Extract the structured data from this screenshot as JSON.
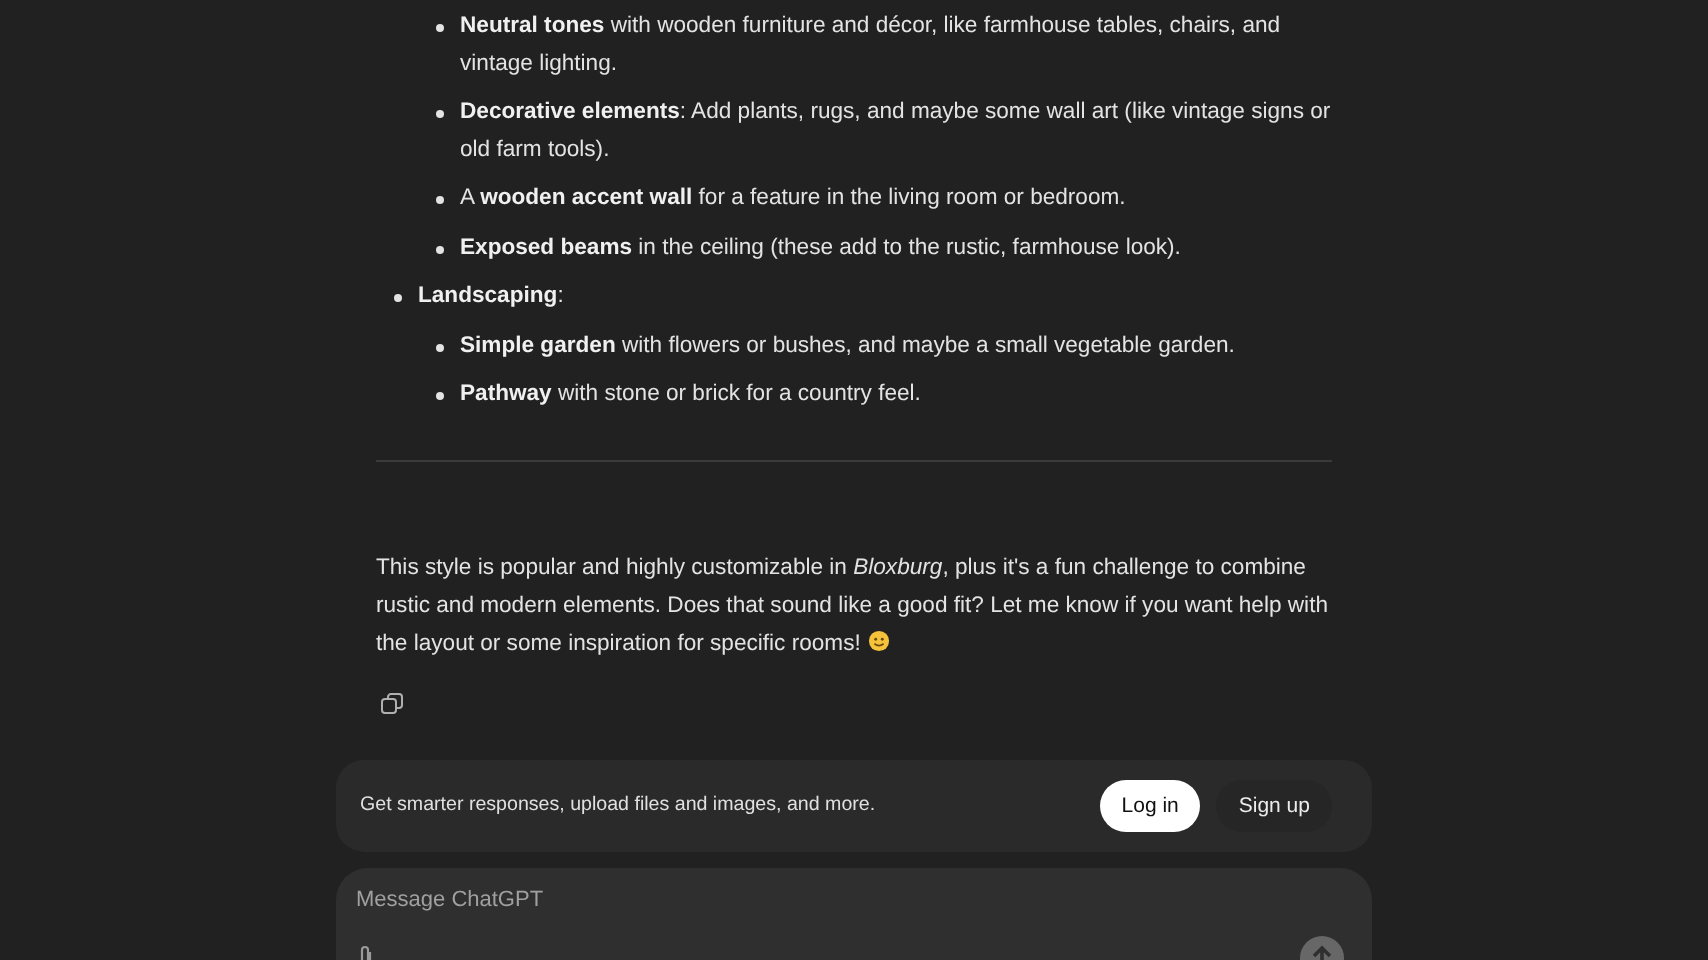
{
  "answer": {
    "list": [
      {
        "children": [
          {
            "text": "**Neutral tones** with wooden furniture and décor, like farmhouse tables, chairs, and vintage lighting."
          },
          {
            "text": "**Decorative elements**: Add plants, rugs, and maybe some wall art (like vintage signs or old farm tools)."
          },
          {
            "text": "A **wooden accent wall** for a feature in the living room or bedroom."
          },
          {
            "text": "**Exposed beams** in the ceiling (these add to the rustic, farmhouse look)."
          }
        ]
      },
      {
        "text": "**Landscaping**:",
        "children": [
          {
            "text": "**Simple garden** with flowers or bushes, and maybe a small vegetable garden."
          },
          {
            "text": "**Pathway** with stone or brick for a country feel."
          }
        ]
      }
    ],
    "closing": "This style is popular and highly customizable in *Bloxburg*, plus it's a fun challenge to combine rustic and modern elements. Does that sound like a good fit? Let me know if you want help with the layout or some inspiration for specific rooms!"
  },
  "banner": {
    "text": "Get smarter responses, upload files and images, and more.",
    "buttons": [
      {
        "label": "Log in",
        "kind": "primary"
      },
      {
        "label": "Sign up",
        "kind": "secondary"
      }
    ]
  },
  "composer": {
    "placeholder": "Message ChatGPT"
  }
}
